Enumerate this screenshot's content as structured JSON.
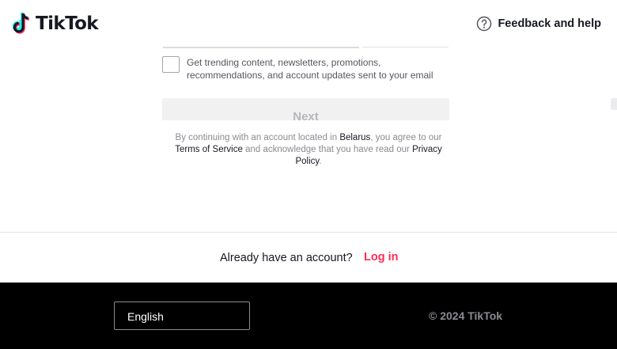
{
  "header": {
    "logo_text": "TikTok",
    "help_label": "Feedback and help",
    "help_icon": "question-circle-icon"
  },
  "form": {
    "marketing_checkbox": {
      "checked": false
    },
    "consent_text": "Get trending content, newsletters, promotions, recommendations, and account updates sent to your email",
    "next_button": "Next",
    "legal": {
      "part1": "By continuing with an account located in ",
      "country": "Belarus",
      "part2": ", you agree to our ",
      "terms_link": "Terms of Service",
      "part3": " and acknowledge that you have read our ",
      "privacy_link": "Privacy Policy",
      "part4": "."
    }
  },
  "login_bar": {
    "question": "Already have an account?",
    "link": "Log in"
  },
  "footer": {
    "language": "English",
    "copyright": "© 2024 TikTok"
  },
  "colors": {
    "brand_red": "#fe2c55",
    "brand_cyan": "#25f4ee",
    "text": "#161823",
    "muted": "#8a8b91"
  }
}
